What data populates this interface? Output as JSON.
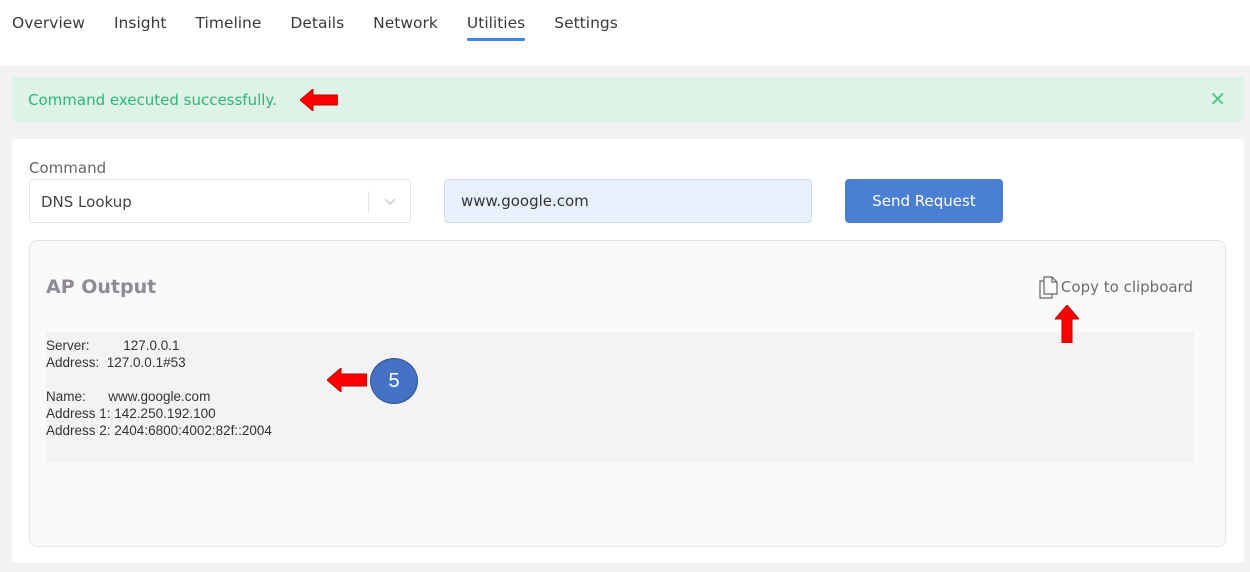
{
  "tabs": [
    {
      "label": "Overview",
      "active": false
    },
    {
      "label": "Insight",
      "active": false
    },
    {
      "label": "Timeline",
      "active": false
    },
    {
      "label": "Details",
      "active": false
    },
    {
      "label": "Network",
      "active": false
    },
    {
      "label": "Utilities",
      "active": true
    },
    {
      "label": "Settings",
      "active": false
    }
  ],
  "alert": {
    "message": "Command executed successfully.",
    "close_icon": "close-icon",
    "color": "#2fb673",
    "background": "#ddf3e7"
  },
  "command": {
    "label": "Command",
    "selected": "DNS Lookup",
    "dropdown_icon": "chevron-down-icon",
    "host_value": "www.google.com",
    "send_label": "Send Request",
    "accent_color": "#4a7fd4"
  },
  "output": {
    "title": "AP Output",
    "copy_label": "Copy to clipboard",
    "copy_icon": "copy-icon",
    "lines": [
      "Server:         127.0.0.1",
      "Address:  127.0.0.1#53",
      "",
      "Name:      www.google.com",
      "Address 1: 142.250.192.100",
      "Address 2: 2404:6800:4002:82f::2004"
    ]
  },
  "annotations": {
    "step_number": "5",
    "arrow_color": "#ff0000",
    "badge_color": "#4472c4"
  }
}
